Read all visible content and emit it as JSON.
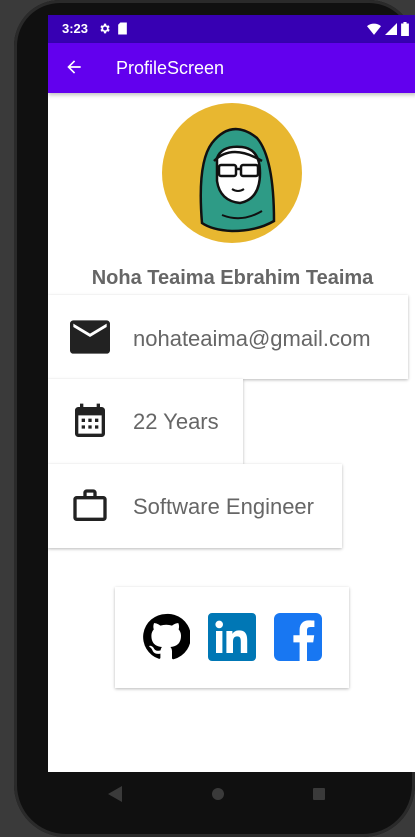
{
  "status_bar": {
    "time": "3:23",
    "icons": [
      "settings-icon",
      "sd-card-icon",
      "wifi-icon",
      "signal-icon",
      "battery-icon"
    ]
  },
  "app_bar": {
    "title": "ProfileScreen",
    "back_icon": "arrow-back-icon",
    "color": "#6200ee",
    "status_color": "#3700b3"
  },
  "profile": {
    "name": "Noha Teaima Ebrahim Teaima",
    "avatar_bg": "#e8b730",
    "details": [
      {
        "icon": "email-icon",
        "text": "nohateaima@gmail.com"
      },
      {
        "icon": "calendar-icon",
        "text": "22 Years"
      },
      {
        "icon": "work-icon",
        "text": "Software Engineer"
      }
    ]
  },
  "social": {
    "links": [
      {
        "icon": "github-icon",
        "color": "#000000"
      },
      {
        "icon": "linkedin-icon",
        "color": "#0077b5"
      },
      {
        "icon": "facebook-icon",
        "color": "#1877f2"
      }
    ]
  },
  "nav_bar": {
    "buttons": [
      "back-nav-icon",
      "home-nav-icon",
      "recents-nav-icon"
    ]
  }
}
